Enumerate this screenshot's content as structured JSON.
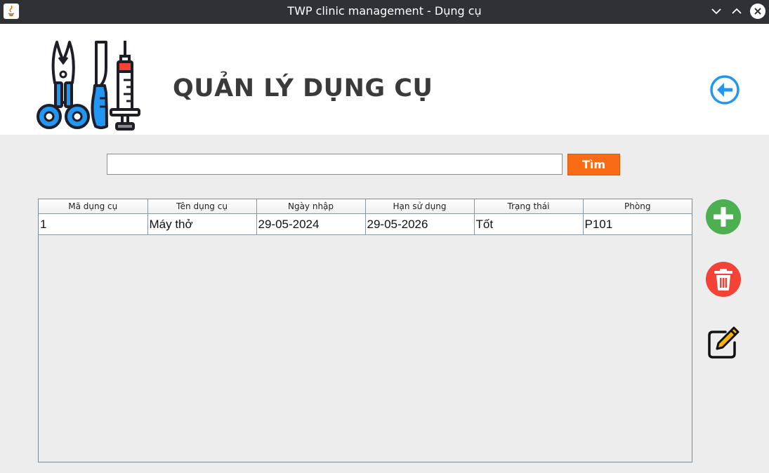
{
  "window": {
    "title": "TWP clinic management - Dụng cụ"
  },
  "header": {
    "title": "QUẢN LÝ DỤNG CỤ"
  },
  "search": {
    "value": "",
    "placeholder": "",
    "button_label": "Tìm"
  },
  "table": {
    "columns": [
      "Mã dụng cụ",
      "Tên dụng cụ",
      "Ngày nhập",
      "Hạn sử dụng",
      "Trạng thái",
      "Phòng"
    ],
    "rows": [
      [
        "1",
        "Máy thở",
        "29-05-2024",
        "29-05-2026",
        "Tốt",
        "P101"
      ]
    ]
  },
  "icons": {
    "back": "arrow-left-circle-icon",
    "add": "plus-circle-icon",
    "delete": "trash-icon",
    "edit": "pencil-square-icon"
  },
  "colors": {
    "titlebar": "#2f3135",
    "accent_blue": "#2196f3",
    "search_button": "#f96b14",
    "add": "#4caf50",
    "delete": "#f44336"
  }
}
